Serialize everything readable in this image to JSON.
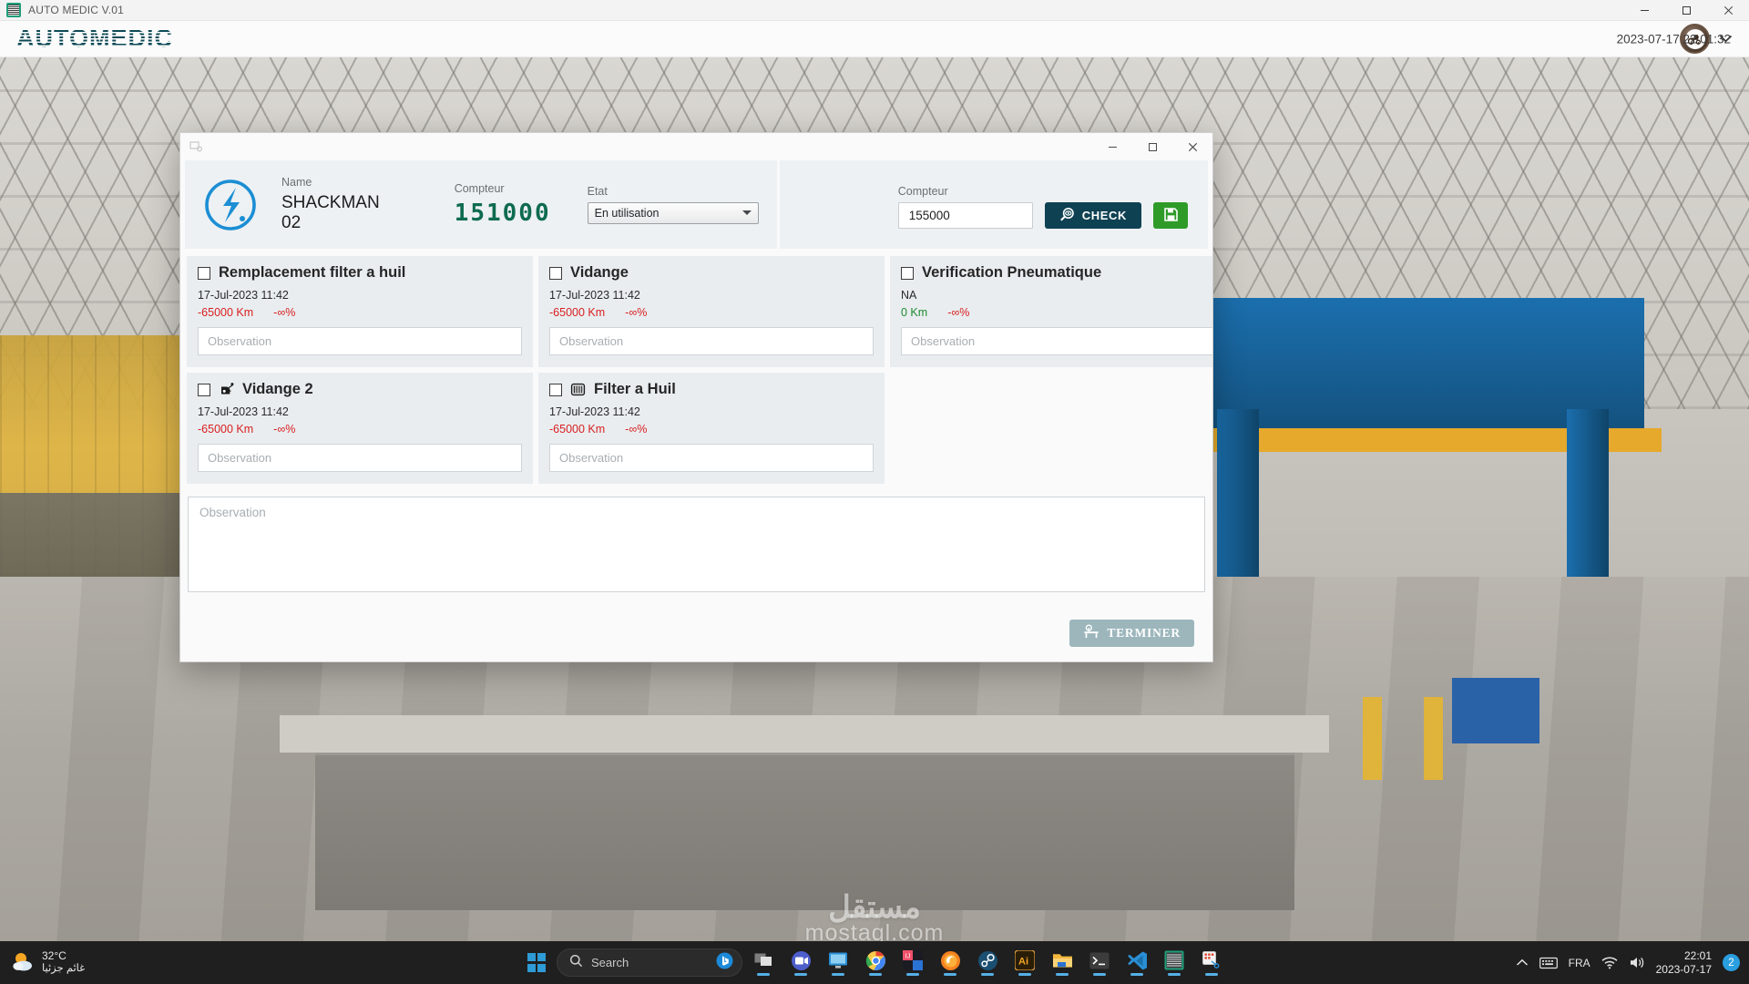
{
  "os_titlebar": {
    "app_title": "AUTO MEDIC V.01",
    "app_icon": "automedic-app-icon",
    "minimize": "–",
    "maximize": "□",
    "close": "✕"
  },
  "header": {
    "brand": "AUTOMEDIC",
    "brand_color": "#0d4a56",
    "avatar_icon": "vehicle-avatar-icon",
    "dropdown_icon": "chevron-down-icon",
    "datetime": "2023-07-17 22:01:32"
  },
  "dialog": {
    "titlebar": {
      "icon": "window-icon",
      "minimize": "–",
      "maximize": "□",
      "close": "✕"
    },
    "vehicle": {
      "logo_icon": "shackman-logo-icon",
      "name_label": "Name",
      "name_value": "SHACKMAN 02",
      "compteur_label": "Compteur",
      "compteur_value": "151000",
      "etat_label": "Etat",
      "etat_value": "En utilisation"
    },
    "counter_entry": {
      "compteur_label": "Compteur",
      "compteur_value": "155000",
      "compteur_placeholder": "Compteur",
      "check_label": "CHECK",
      "check_icon": "magnifier-eye-icon",
      "check_color": "#0e4152",
      "save_icon": "floppy-save-icon",
      "save_color": "#2e9b29"
    },
    "tasks": [
      {
        "title": "Remplacement filter a huil",
        "icon": "",
        "checked": false,
        "date": "17-Jul-2023 11:42",
        "km": "-65000 Km",
        "km_state": "neg",
        "percent": "-∞%",
        "percent_state": "neg",
        "observation_placeholder": "Observation",
        "observation_value": ""
      },
      {
        "title": "Vidange",
        "icon": "",
        "checked": false,
        "date": "17-Jul-2023 11:42",
        "km": "-65000 Km",
        "km_state": "neg",
        "percent": "-∞%",
        "percent_state": "neg",
        "observation_placeholder": "Observation",
        "observation_value": ""
      },
      {
        "title": "Verification Pneumatique",
        "icon": "",
        "checked": false,
        "date": "NA",
        "km": "0 Km",
        "km_state": "pos",
        "percent": "-∞%",
        "percent_state": "neg",
        "observation_placeholder": "Observation",
        "observation_value": ""
      },
      {
        "title": "Vidange 2",
        "icon": "oil-can-icon",
        "checked": false,
        "date": "17-Jul-2023 11:42",
        "km": "-65000 Km",
        "km_state": "neg",
        "percent": "-∞%",
        "percent_state": "neg",
        "observation_placeholder": "Observation",
        "observation_value": ""
      },
      {
        "title": "Filter a Huil",
        "icon": "oil-filter-icon",
        "checked": false,
        "date": "17-Jul-2023 11:42",
        "km": "-65000 Km",
        "km_state": "neg",
        "percent": "-∞%",
        "percent_state": "neg",
        "observation_placeholder": "Observation",
        "observation_value": ""
      }
    ],
    "global_observation": {
      "placeholder": "Observation",
      "value": ""
    },
    "footer": {
      "terminer_label": "TERMINER",
      "terminer_icon": "workbench-icon",
      "terminer_color": "#9cb6bc"
    }
  },
  "desktop": {
    "watermark_main": "مستقل",
    "watermark_sub": "mostaql.com"
  },
  "taskbar": {
    "weather": {
      "icon": "sun-behind-cloud-icon",
      "temperature": "32°C",
      "description": "غائم جزئيا"
    },
    "start_icon": "windows-start-icon",
    "search": {
      "icon": "search-icon",
      "placeholder": "Search",
      "bing_icon": "bing-chat-icon"
    },
    "apps": [
      {
        "name": "task-view-icon",
        "active": true
      },
      {
        "name": "teams-icon",
        "active": true
      },
      {
        "name": "remote-desktop-icon",
        "active": true
      },
      {
        "name": "chrome-icon",
        "active": true
      },
      {
        "name": "intellij-idea-icon",
        "active": true
      },
      {
        "name": "firefox-icon",
        "active": true
      },
      {
        "name": "steam-icon",
        "active": true
      },
      {
        "name": "illustrator-icon",
        "active": true
      },
      {
        "name": "file-explorer-icon",
        "active": true
      },
      {
        "name": "terminal-icon",
        "active": true
      },
      {
        "name": "vscode-icon",
        "active": true
      },
      {
        "name": "automedic-icon",
        "active": true
      },
      {
        "name": "snipping-tool-icon",
        "active": true
      }
    ],
    "tray": {
      "overflow_icon": "chevron-up-icon",
      "keyboard_icon": "keyboard-icon",
      "language": "FRA",
      "wifi_icon": "wifi-icon",
      "volume_icon": "volume-icon",
      "time": "22:01",
      "date": "2023-07-17",
      "notification_count": "2"
    }
  }
}
